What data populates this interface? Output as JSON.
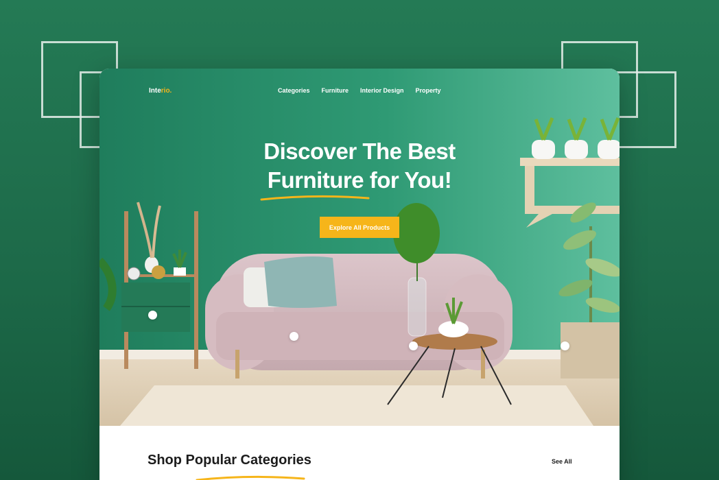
{
  "brand": {
    "name_main": "Inte",
    "name_accent": "rio.",
    "accent_color": "#f6b51a"
  },
  "nav": {
    "items": [
      "Categories",
      "Furniture",
      "Interior Design",
      "Property"
    ]
  },
  "hero": {
    "title_line1": "Discover The Best",
    "title_line2": "Furniture for You!",
    "cta_label": "Explore All Products",
    "background_color": "#2f9a74"
  },
  "section": {
    "title": "Shop Popular Categories",
    "see_all_label": "See All"
  },
  "colors": {
    "page_background": "#1f6f4d",
    "accent": "#f6b51a",
    "wall": "#2f9a74",
    "sofa": "#d2b8bd"
  }
}
